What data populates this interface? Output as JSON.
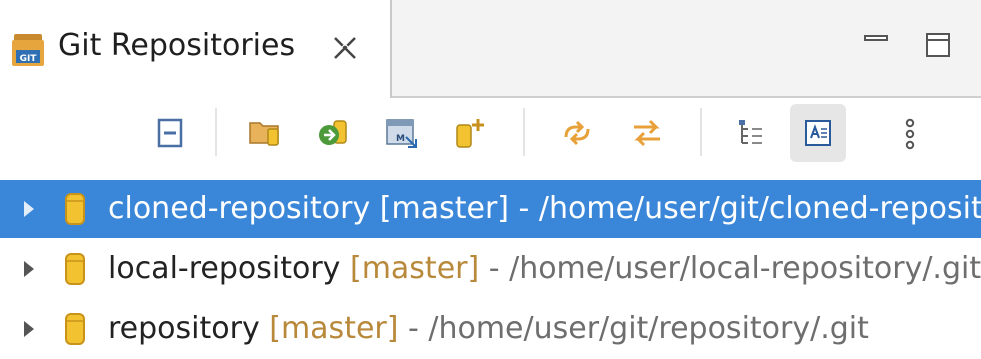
{
  "view": {
    "title": "Git Repositories",
    "icons": {
      "view_icon": "git-repositories-icon",
      "close": "close-icon",
      "minimize": "minimize-icon",
      "maximize": "maximize-icon"
    }
  },
  "toolbar": {
    "buttons": [
      {
        "name": "collapse-all-icon"
      },
      {
        "name": "add-existing-repository-icon"
      },
      {
        "name": "clone-repository-icon"
      },
      {
        "name": "import-projects-icon"
      },
      {
        "name": "create-repository-icon"
      },
      {
        "name": "refresh-icon"
      },
      {
        "name": "link-with-selection-icon"
      },
      {
        "name": "hierarchical-layout-icon"
      },
      {
        "name": "show-details-icon",
        "active": true
      },
      {
        "name": "view-menu-icon"
      }
    ]
  },
  "repositories": [
    {
      "name": "cloned-repository",
      "branch": "[master]",
      "path": " - /home/user/git/cloned-repository/.git",
      "selected": true
    },
    {
      "name": "local-repository",
      "branch": "[master]",
      "path": " - /home/user/local-repository/.git",
      "selected": false
    },
    {
      "name": "repository",
      "branch": "[master]",
      "path": " - /home/user/git/repository/.git",
      "selected": false
    }
  ],
  "colors": {
    "selection": "#3a86d8",
    "branch": "#b8893a",
    "repo_icon": "#f2c230"
  }
}
